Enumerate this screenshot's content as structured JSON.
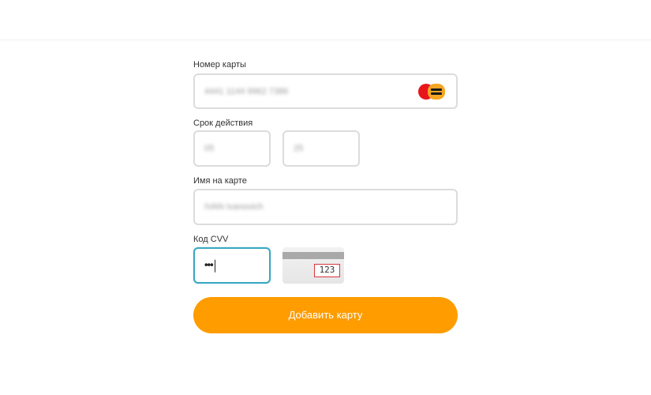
{
  "form": {
    "card_number": {
      "label": "Номер карты",
      "value": "4441 1144 9962 7386",
      "icon": "mastercard-logo-icon"
    },
    "expiry": {
      "label": "Срок действия",
      "month": "05",
      "year": "25"
    },
    "cardholder": {
      "label": "Имя на карте",
      "value": "IVAN Ivanovich"
    },
    "cvv": {
      "label": "Код CVV",
      "value": "•••",
      "hint_code": "123"
    },
    "submit_label": "Добавить карту"
  },
  "colors": {
    "accent": "#fe9c00",
    "focus_border": "#3aa8c1",
    "field_border": "#dcdcdc",
    "hint_highlight": "#d9363e"
  }
}
